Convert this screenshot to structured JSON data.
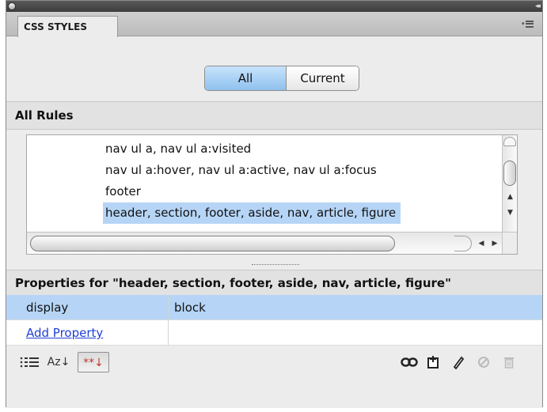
{
  "panel": {
    "tab_label": "CSS STYLES",
    "collapse_glyph": "◂◂"
  },
  "mode_toggle": {
    "all_label": "All",
    "current_label": "Current",
    "selected": "All"
  },
  "rules_section": {
    "heading": "All Rules",
    "rules": [
      {
        "label": "nav ul a, nav ul a:visited",
        "selected": false
      },
      {
        "label": "nav ul a:hover, nav ul a:active, nav ul a:focus",
        "selected": false
      },
      {
        "label": "footer",
        "selected": false
      },
      {
        "label": "header, section, footer, aside, nav, article, figure",
        "selected": true
      }
    ]
  },
  "properties_section": {
    "heading": "Properties for \"header, section, footer, aside, nav, article, figure\"",
    "rows": [
      {
        "name": "display",
        "value": "block"
      }
    ],
    "add_property_label": "Add Property"
  },
  "toolbar": {
    "left_icons": [
      "category-view-icon",
      "alphabetical-view-icon",
      "set-properties-view-icon"
    ],
    "right_icons": [
      "attach-style-sheet-icon",
      "new-css-rule-icon",
      "edit-rule-icon",
      "disable-property-icon",
      "delete-rule-icon"
    ],
    "alpha_glyph": "Az↓",
    "set_glyph": "**↓"
  },
  "colors": {
    "selection": "#b6d5f6",
    "link": "#1f3fd6",
    "segment_active": "#8fc1ef"
  }
}
